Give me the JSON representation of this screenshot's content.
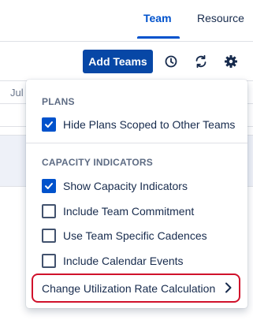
{
  "tabs": [
    {
      "label": "Team",
      "active": true
    },
    {
      "label": "Resource",
      "active": false
    }
  ],
  "toolbar": {
    "add_teams_label": "Add Teams",
    "icons": [
      "clock-icon",
      "refresh-icon",
      "gear-icon"
    ]
  },
  "timeline": {
    "month_label": "Jul"
  },
  "popup": {
    "plans_title": "PLANS",
    "plans_options": [
      {
        "label": "Hide Plans Scoped to Other Teams",
        "checked": true
      }
    ],
    "capacity_title": "CAPACITY INDICATORS",
    "capacity_options": [
      {
        "label": "Show Capacity Indicators",
        "checked": true
      },
      {
        "label": "Include Team Commitment",
        "checked": false
      },
      {
        "label": "Use Team Specific Cadences",
        "checked": false
      },
      {
        "label": "Include Calendar Events",
        "checked": false
      }
    ],
    "change_rate_label": "Change Utilization Rate Calculation"
  },
  "colors": {
    "accent": "#0052cc",
    "primary_button": "#0747a6",
    "highlight_border": "#d0112b"
  }
}
